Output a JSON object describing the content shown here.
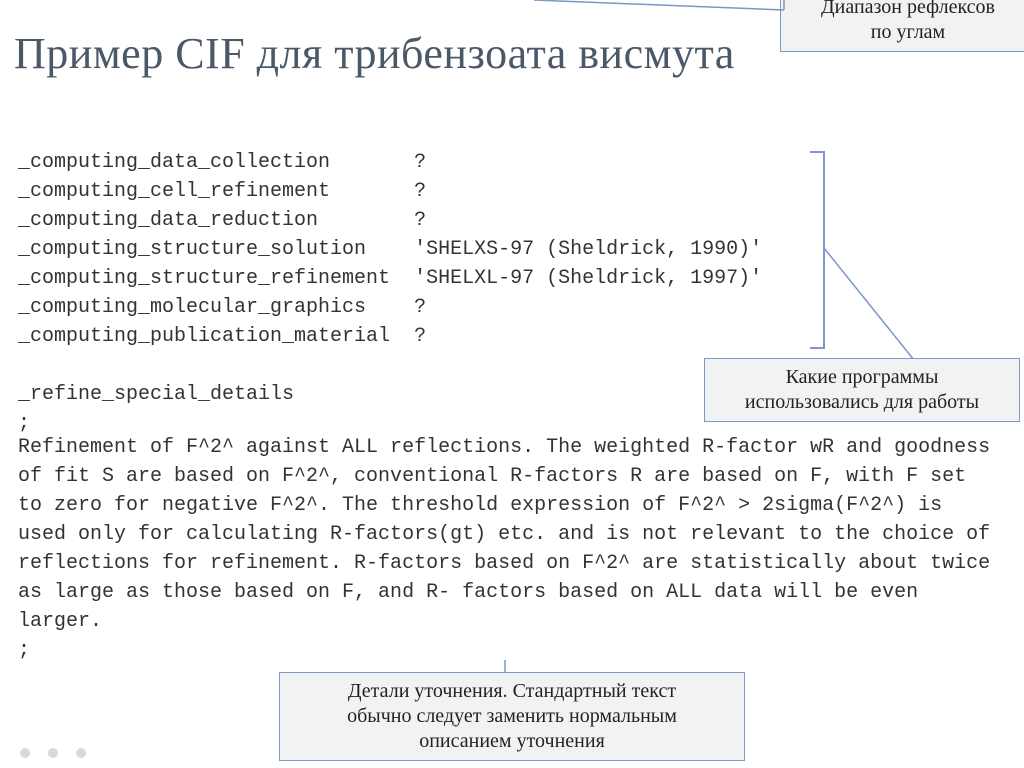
{
  "title": "Пример CIF для трибензоата висмута",
  "callout_top": "Диапазон рефлексов\nпо углам",
  "callout_mid": "Какие программы\nиспользовались для работы",
  "callout_bottom": "Детали уточнения. Стандартный текст\nобычно следует заменить нормальным\nописанием уточнения",
  "cif_header": "_computing_data_collection       ?\n_computing_cell_refinement       ?\n_computing_data_reduction        ?\n_computing_structure_solution    'SHELXS-97 (Sheldrick, 1990)'\n_computing_structure_refinement  'SHELXL-97 (Sheldrick, 1997)'\n_computing_molecular_graphics    ?\n_computing_publication_material  ?\n\n_refine_special_details\n;",
  "cif_body": " Refinement of F^2^ against ALL reflections.  The weighted R-factor wR and goodness of fit S are based on F^2^, conventional R-factors R are based on F, with F set to zero for negative F^2^. The threshold expression of F^2^ > 2sigma(F^2^) is used only for calculating R-factors(gt) etc. and is not relevant to the choice of reflections for refinement.  R-factors based on F^2^ are statistically about twice as large as those based on F, and R- factors based on ALL data will be even larger.",
  "cif_close": ";"
}
